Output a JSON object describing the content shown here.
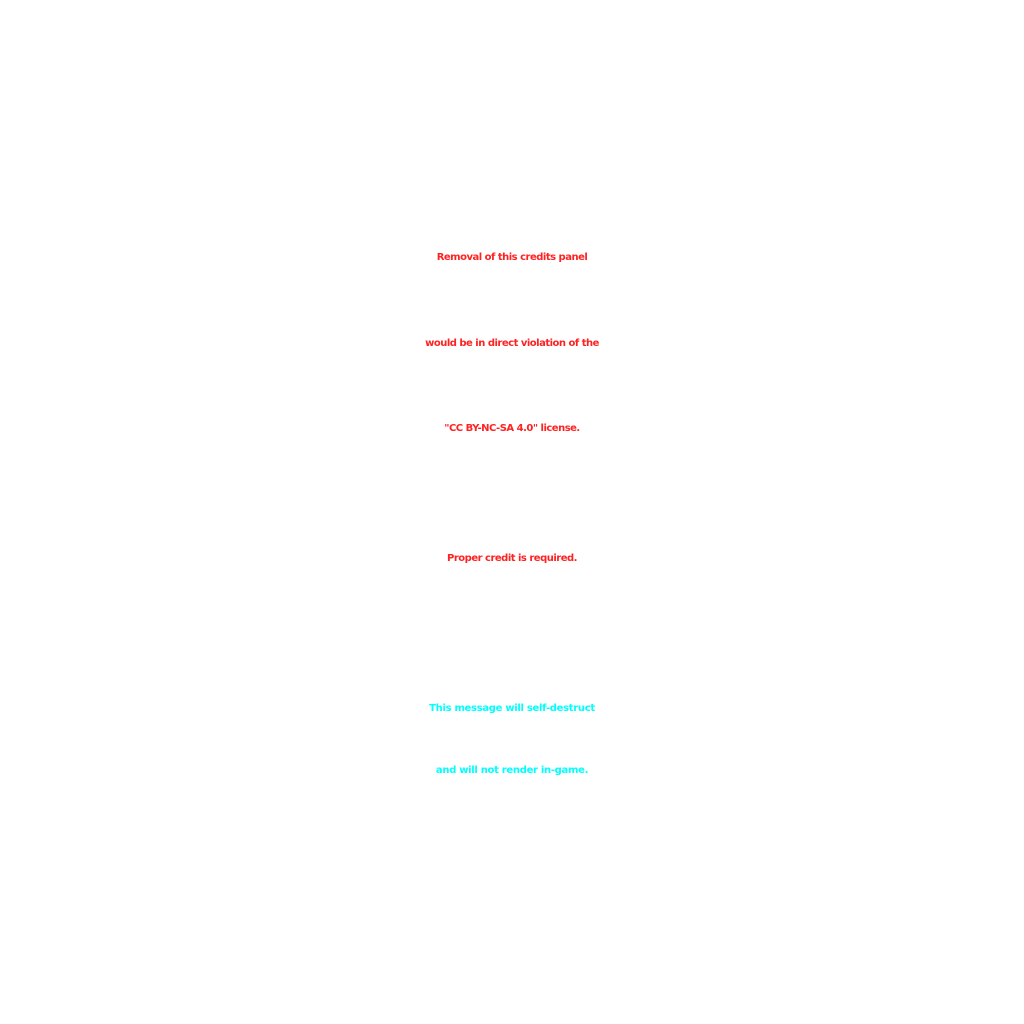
{
  "colors": {
    "background": "#ffffff",
    "warning": "#fe2222",
    "note": "#00ffff"
  },
  "warning": {
    "lines": [
      "Removal of this credits panel",
      "would be in direct violation of the",
      "\"CC BY-NC-SA 4.0\" license."
    ],
    "requirement": "Proper credit is required."
  },
  "note": {
    "lines": [
      "This message will self-destruct",
      "and will not render in-game."
    ]
  }
}
